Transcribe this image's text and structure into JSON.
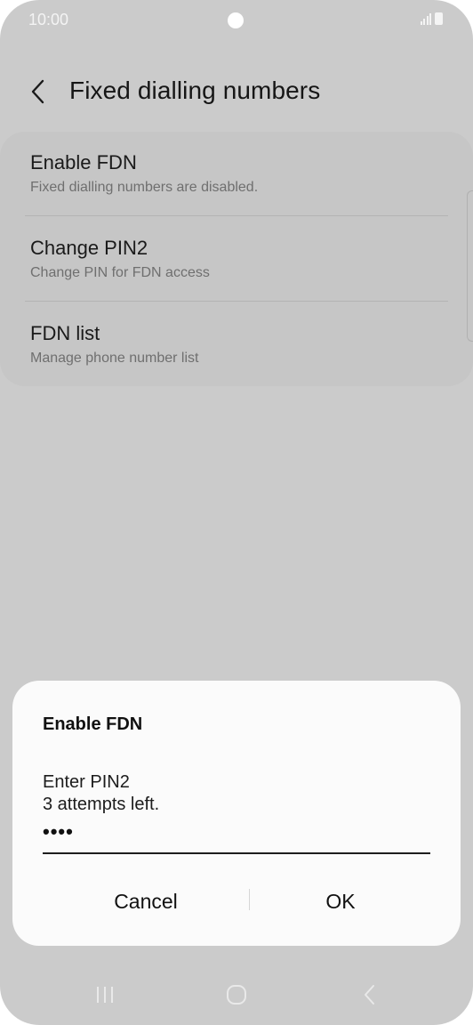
{
  "status_bar": {
    "time": "10:00"
  },
  "header": {
    "back_icon": "back-chevron-icon",
    "title": "Fixed dialling numbers"
  },
  "settings": {
    "items": [
      {
        "title": "Enable FDN",
        "subtitle": "Fixed dialling numbers are disabled."
      },
      {
        "title": "Change PIN2",
        "subtitle": "Change PIN for FDN access"
      },
      {
        "title": "FDN list",
        "subtitle": "Manage phone number list"
      }
    ]
  },
  "dialog": {
    "title": "Enable FDN",
    "message_line1": "Enter PIN2",
    "message_line2": "3 attempts left.",
    "pin_value": "••••",
    "cancel_label": "Cancel",
    "ok_label": "OK"
  },
  "nav_bar": {
    "recent_icon": "recent-apps-icon",
    "home_icon": "home-icon",
    "back_icon": "back-icon"
  },
  "colors": {
    "screen_bg": "#cbcbcb",
    "card_bg": "#c6c6c6",
    "dialog_bg": "#fbfbfb"
  }
}
